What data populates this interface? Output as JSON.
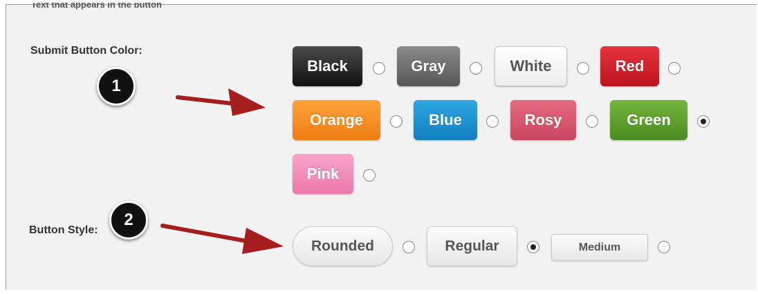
{
  "form": {
    "cut_text": "Text that appears in the button",
    "color_label": "Submit Button Color:",
    "style_label": "Button Style:",
    "color_options": [
      {
        "label": "Black",
        "bg": "#2b2b2b",
        "checked": false
      },
      {
        "label": "Gray",
        "bg": "#6e6e6e",
        "checked": false
      },
      {
        "label": "White",
        "bg": "#f7f7f7",
        "checked": false
      },
      {
        "label": "Red",
        "bg": "#d21f2a",
        "checked": false
      },
      {
        "label": "Orange",
        "bg": "#f58a1f",
        "checked": false
      },
      {
        "label": "Blue",
        "bg": "#1a8fcf",
        "checked": false
      },
      {
        "label": "Rosy",
        "bg": "#d8526a",
        "checked": false
      },
      {
        "label": "Green",
        "bg": "#5c9e2c",
        "checked": true
      },
      {
        "label": "Pink",
        "bg": "#f28ab9",
        "checked": false
      }
    ],
    "style_options": [
      {
        "label": "Rounded",
        "checked": false
      },
      {
        "label": "Regular",
        "checked": true
      },
      {
        "label": "Medium",
        "checked": false
      }
    ]
  },
  "annotations": {
    "badge_1": "1",
    "badge_2": "2",
    "arrow_color": "#a51d1d"
  }
}
